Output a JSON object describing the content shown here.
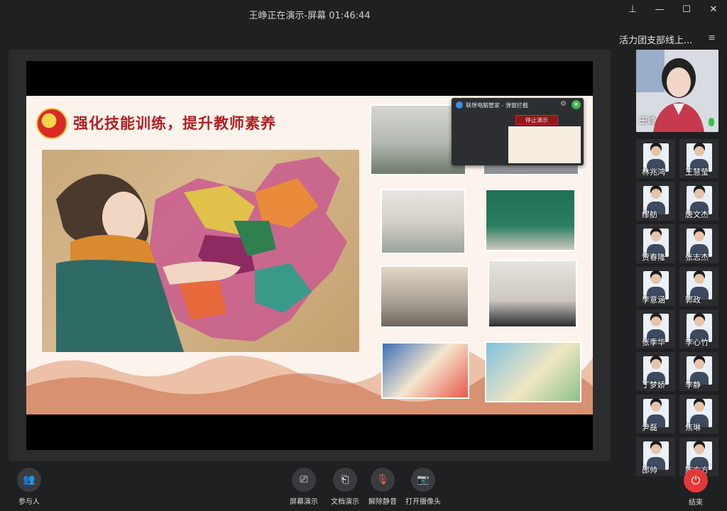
{
  "window": {
    "title": "王峥正在演示-屏幕 01:46:44",
    "controls": [
      "pin",
      "minimize",
      "maximize",
      "close"
    ]
  },
  "slide": {
    "title": "强化技能训练，提升教师素养"
  },
  "popup": {
    "title": "联想电脑管家 - 弹窗拦截",
    "stop_label": "停止演示"
  },
  "sidebar": {
    "room_title": "活力团支部线上...",
    "host": {
      "name": "王峥"
    },
    "participants": [
      "林兆鸿",
      "王慧莹",
      "缪舫",
      "唐文杰",
      "贾春隆",
      "张志杰",
      "李意涵",
      "郭政",
      "张季华",
      "李心竹",
      "丁梦娇",
      "李静",
      "尹磊",
      "焦琳",
      "邵帅",
      "陈方方"
    ]
  },
  "toolbar": {
    "participants_label": "参与人",
    "screen_share_label": "屏幕演示",
    "doc_share_label": "文档演示",
    "unmute_label": "解除静音",
    "camera_label": "打开摄像头",
    "end_label": "结束"
  },
  "colors": {
    "accent_red": "#e5383b",
    "title_red": "#b21f22",
    "mic_green": "#37c249"
  }
}
